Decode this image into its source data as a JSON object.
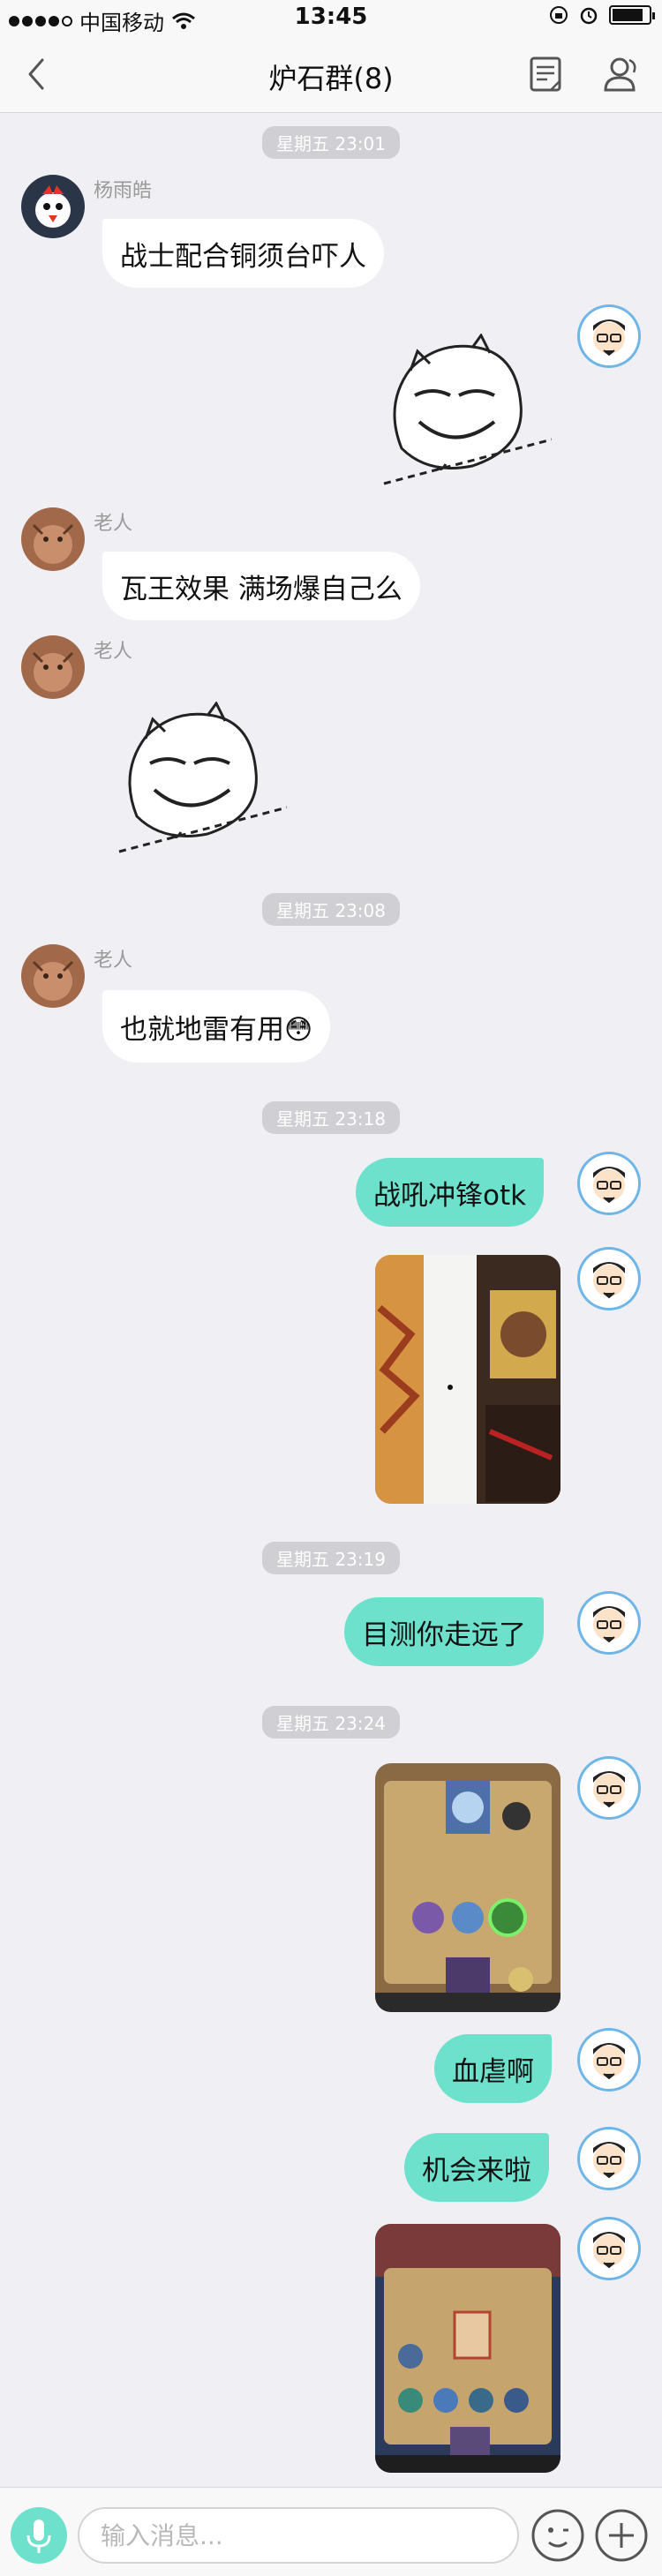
{
  "status_bar": {
    "carrier": "中国移动",
    "time": "13:45",
    "battery_level": 0.85
  },
  "header": {
    "title": "炉石群(8)",
    "icons": [
      "back-chevron-icon",
      "notes-icon",
      "group-members-icon"
    ]
  },
  "chat": {
    "timestamps": [
      "星期五 23:01",
      "星期五 23:08",
      "星期五 23:18",
      "星期五 23:19",
      "星期五 23:24"
    ],
    "messages": [
      {
        "sender": "杨雨皓",
        "side": "in",
        "type": "text",
        "text": "战士配合铜须台吓人"
      },
      {
        "sender": "me",
        "side": "out",
        "type": "sticker",
        "sticker": "smirk-face-sticker"
      },
      {
        "sender": "老人",
        "side": "in",
        "type": "text",
        "text": "瓦王效果 满场爆自己么"
      },
      {
        "sender": "老人",
        "side": "in",
        "type": "sticker",
        "sticker": "smirk-face-sticker"
      },
      {
        "sender": "老人",
        "side": "in",
        "type": "text",
        "text": "也就地雷有用😳"
      },
      {
        "sender": "me",
        "side": "out",
        "type": "text",
        "text": "战吼冲锋otk"
      },
      {
        "sender": "me",
        "side": "out",
        "type": "image",
        "image": "game-card-photo"
      },
      {
        "sender": "me",
        "side": "out",
        "type": "text",
        "text": "目测你走远了"
      },
      {
        "sender": "me",
        "side": "out",
        "type": "image",
        "image": "game-board-photo"
      },
      {
        "sender": "me",
        "side": "out",
        "type": "text",
        "text": "血虐啊"
      },
      {
        "sender": "me",
        "side": "out",
        "type": "text",
        "text": "机会来啦"
      },
      {
        "sender": "me",
        "side": "out",
        "type": "image",
        "image": "game-board-photo-2"
      }
    ]
  },
  "input_bar": {
    "placeholder": "输入消息..."
  },
  "colors": {
    "outgoing_bubble": "#6ee1cc",
    "incoming_bubble": "#ffffff",
    "background": "#efeff4"
  }
}
